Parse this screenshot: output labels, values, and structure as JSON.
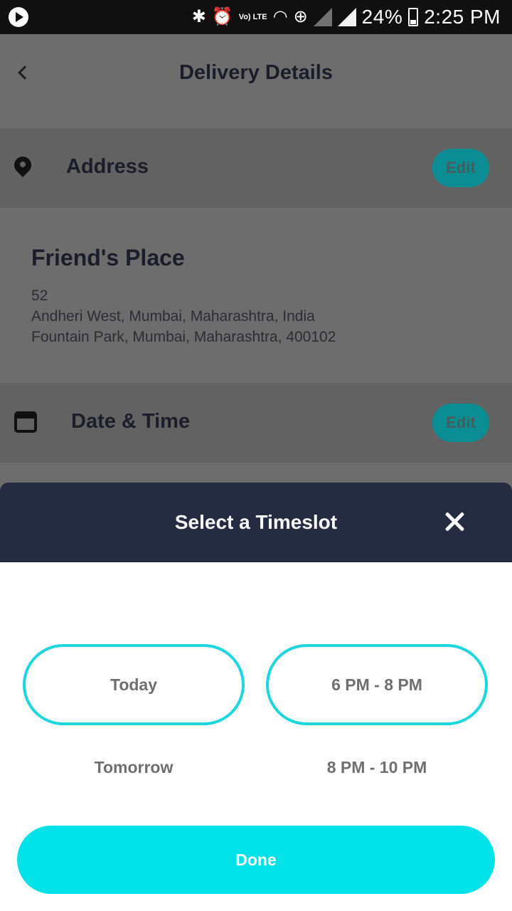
{
  "status_bar": {
    "battery": "24%",
    "time": "2:25 PM",
    "lte_label": "Vo) LTE",
    "icons": [
      "play-icon",
      "bluetooth-icon",
      "alarm-icon",
      "volte-icon",
      "wifi-icon",
      "globe-icon",
      "signal-icon",
      "battery-icon"
    ]
  },
  "header": {
    "title": "Delivery Details",
    "back_icon": "chevron-left-icon"
  },
  "address_section": {
    "title": "Address",
    "edit_label": "Edit",
    "icon": "map-pin-icon"
  },
  "address": {
    "name": "Friend's Place",
    "lines": [
      "52",
      "Andheri West, Mumbai, Maharashtra, India",
      "Fountain Park, Mumbai, Maharashtra, 400102"
    ]
  },
  "datetime_section": {
    "title": "Date & Time",
    "edit_label": "Edit",
    "icon": "calendar-icon"
  },
  "timeslot_sheet": {
    "title": "Select a Timeslot",
    "close_icon": "close-icon",
    "days": [
      {
        "label": "Today",
        "selected": true
      },
      {
        "label": "Tomorrow",
        "selected": false
      }
    ],
    "slots": [
      {
        "label": "6 PM - 8 PM",
        "selected": true
      },
      {
        "label": "8 PM - 10 PM",
        "selected": false
      }
    ],
    "done_label": "Done"
  },
  "colors": {
    "accent": "#00e2e8",
    "sheet_header": "#252c42",
    "edit_button": "#0a8d93"
  }
}
